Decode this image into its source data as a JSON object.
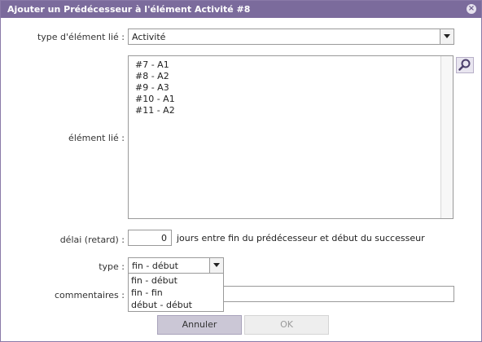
{
  "dialog": {
    "title": "Ajouter un Prédécesseur à l'élément Activité #8",
    "close_glyph": "×"
  },
  "form": {
    "element_type": {
      "label": "type d'élément lié :",
      "value": "Activité"
    },
    "linked_element": {
      "label": "élément lié :",
      "items": [
        "#7 - A1",
        "#8 - A2",
        "#9 - A3",
        "#10 - A1",
        "#11 - A2"
      ],
      "search_icon": "magnifier-icon"
    },
    "delay": {
      "label": "délai (retard) :",
      "value": "0",
      "suffix": "jours entre fin du prédécesseur et début du successeur"
    },
    "type": {
      "label": "type :",
      "value": "fin - début",
      "options": [
        "fin - début",
        "fin - fin",
        "début - début"
      ]
    },
    "comments": {
      "label": "commentaires :",
      "value": ""
    }
  },
  "buttons": {
    "cancel": "Annuler",
    "ok": "OK"
  },
  "colors": {
    "titlebar": "#7b6b9c",
    "cancel_button": "#cbc7d6"
  }
}
